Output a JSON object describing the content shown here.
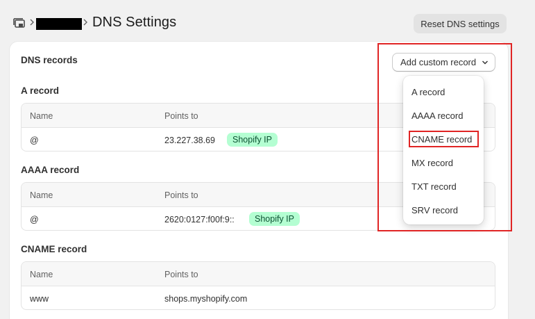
{
  "header": {
    "breadcrumb_store": "",
    "title": "DNS Settings",
    "reset_button": "Reset DNS settings"
  },
  "card": {
    "title": "DNS records",
    "add_button": "Add custom record"
  },
  "sections": [
    {
      "title": "A record",
      "columns": [
        "Name",
        "Points to"
      ],
      "row": {
        "name": "@",
        "points_to": "23.227.38.69",
        "badge": "Shopify IP"
      }
    },
    {
      "title": "AAAA record",
      "columns": [
        "Name",
        "Points to"
      ],
      "row": {
        "name": "@",
        "points_to": "2620:0127:f00f:9::",
        "badge": "Shopify IP"
      }
    },
    {
      "title": "CNAME record",
      "columns": [
        "Name",
        "Points to"
      ],
      "row": {
        "name": "www",
        "points_to": "shops.myshopify.com"
      }
    }
  ],
  "dropdown": {
    "items": [
      "A record",
      "AAAA record",
      "CNAME record",
      "MX record",
      "TXT record",
      "SRV record"
    ],
    "highlighted": "CNAME record"
  },
  "colors": {
    "badge_bg": "#b4fed2",
    "badge_text": "#0c5132",
    "annotation": "#e02424"
  }
}
